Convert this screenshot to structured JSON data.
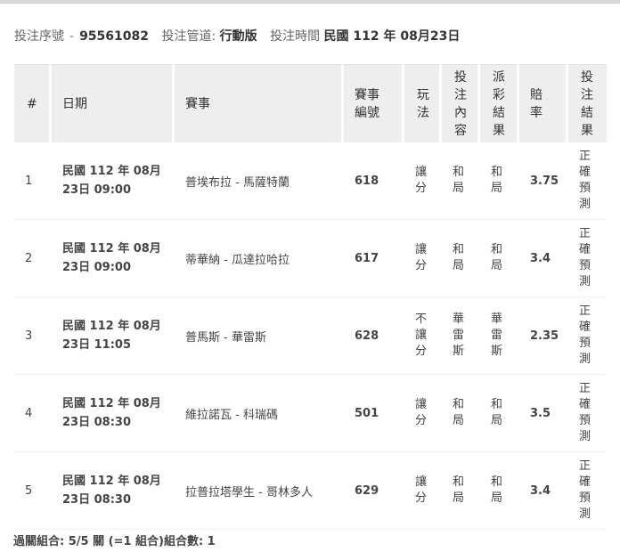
{
  "header": {
    "serial_label": "投注序號",
    "serial_value": "95561082",
    "channel_label": "投注管道:",
    "channel_value": "行動版",
    "time_label": "投注時間",
    "time_value": "民國 112 年 08月23日"
  },
  "table": {
    "columns": {
      "index": "#",
      "date": "日期",
      "event": "賽事",
      "event_no": "賽事\n編號",
      "play": "玩\n法",
      "bet": "投\n注\n內\n容",
      "payout": "派\n彩\n結\n果",
      "odds": "賠\n率",
      "result": "投\n注\n結\n果"
    },
    "rows": [
      {
        "index": "1",
        "date": "民國 112 年 08月\n23日 09:00",
        "event": "普埃布拉 - 馬薩特蘭",
        "event_no": "618",
        "play": "讓\n分",
        "bet": "和\n局",
        "payout": "和\n局",
        "odds": "3.75",
        "result": "正\n確\n預\n測"
      },
      {
        "index": "2",
        "date": "民國 112 年 08月\n23日 09:00",
        "event": "蒂華納 - 瓜達拉哈拉",
        "event_no": "617",
        "play": "讓\n分",
        "bet": "和\n局",
        "payout": "和\n局",
        "odds": "3.4",
        "result": "正\n確\n預\n測"
      },
      {
        "index": "3",
        "date": "民國 112 年 08月\n23日 11:05",
        "event": "普馬斯 - 華雷斯",
        "event_no": "628",
        "play": "不\n讓\n分",
        "bet": "華\n雷\n斯",
        "payout": "華\n雷\n斯",
        "odds": "2.35",
        "result": "正\n確\n預\n測"
      },
      {
        "index": "4",
        "date": "民國 112 年 08月\n23日 08:30",
        "event": "維拉諾瓦 - 科瑞碼",
        "event_no": "501",
        "play": "讓\n分",
        "bet": "和\n局",
        "payout": "和\n局",
        "odds": "3.5",
        "result": "正\n確\n預\n測"
      },
      {
        "index": "5",
        "date": "民國 112 年 08月\n23日 08:30",
        "event": "拉普拉塔學生 - 哥林多人",
        "event_no": "629",
        "play": "讓\n分",
        "bet": "和\n局",
        "payout": "和\n局",
        "odds": "3.4",
        "result": "正\n確\n預\n測"
      }
    ]
  },
  "footer": {
    "summary": "過關組合: 5/5 關 (=1 組合)組合數: 1"
  }
}
